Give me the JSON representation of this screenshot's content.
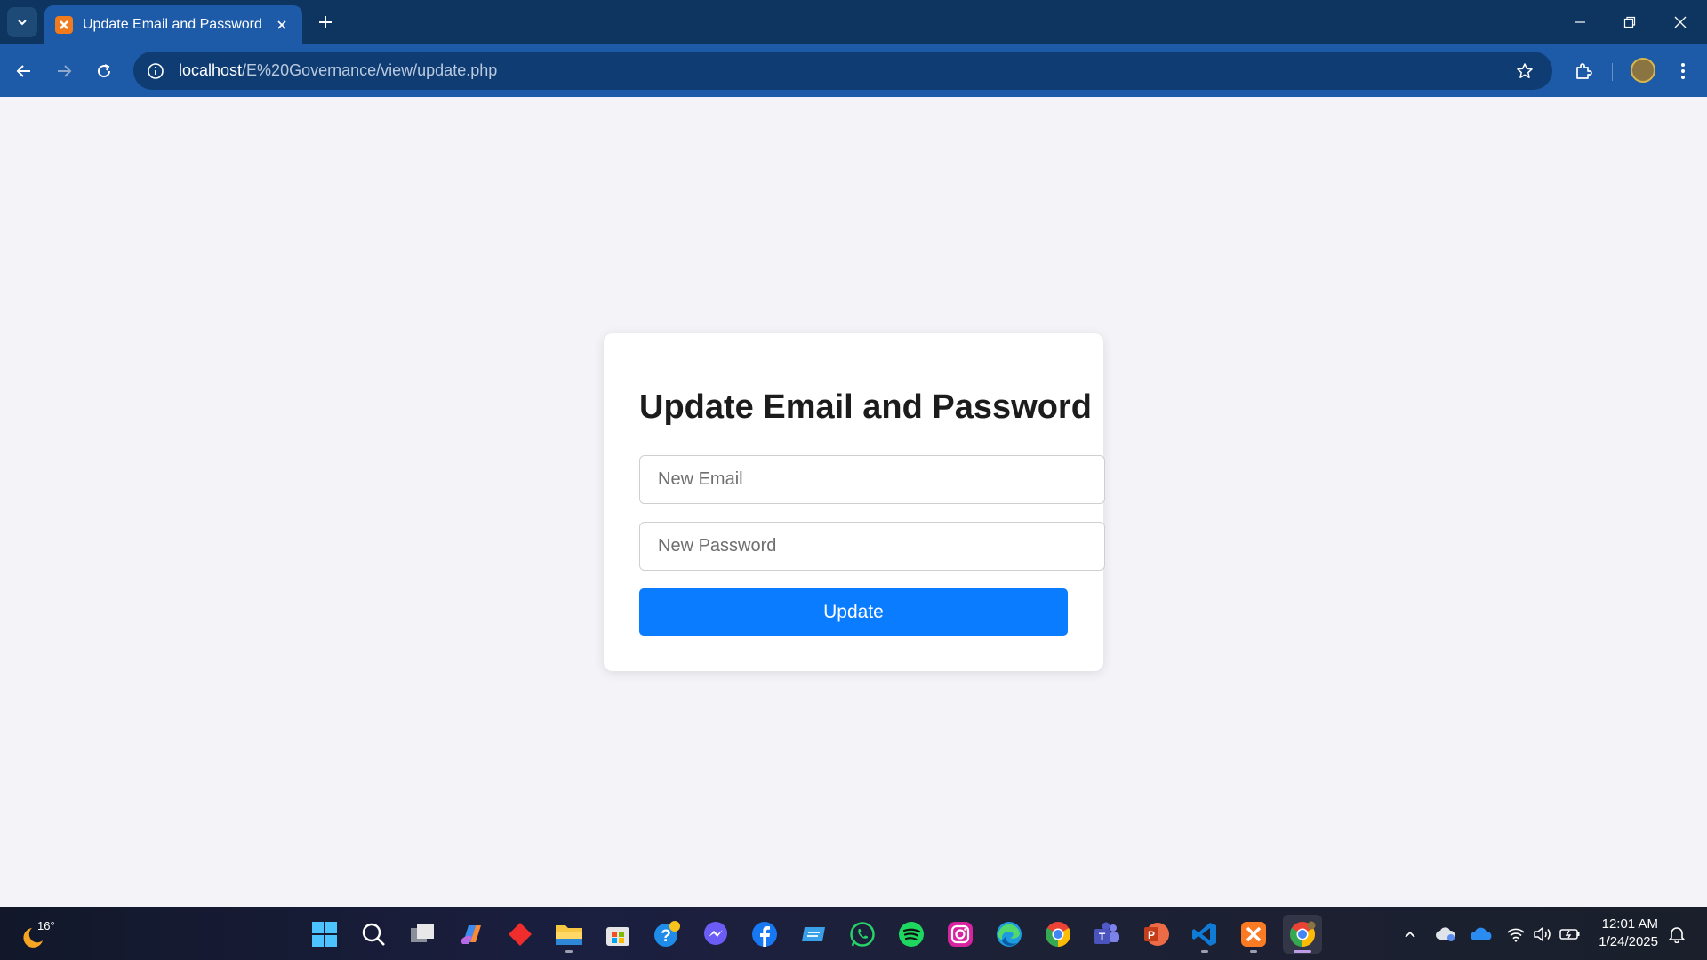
{
  "browser": {
    "tab_title": "Update Email and Password",
    "url_host": "localhost",
    "url_path": "/E%20Governance/view/update.php"
  },
  "form": {
    "title": "Update Email and Password",
    "email_placeholder": "New Email",
    "password_placeholder": "New Password",
    "submit_label": "Update"
  },
  "taskbar": {
    "weather_temp": "16°",
    "apps": [
      "start-icon",
      "search-icon",
      "task-view-icon",
      "copilot-icon",
      "anydesk-icon",
      "file-explorer-icon",
      "microsoft-store-icon",
      "get-help-icon",
      "messenger-icon",
      "facebook-icon",
      "remote-desktop-icon",
      "whatsapp-icon",
      "spotify-icon",
      "instagram-icon",
      "edge-icon",
      "chrome-icon",
      "teams-icon",
      "powerpoint-icon",
      "vscode-icon",
      "xampp-icon",
      "chrome-profile-icon"
    ],
    "time": "12:01 AM",
    "date": "1/24/2025"
  },
  "colors": {
    "accent": "#0a7cff",
    "chrome_toolbar": "#1d5aa8",
    "chrome_tabbar": "#0d3560",
    "page_bg": "#f4f4f8"
  }
}
